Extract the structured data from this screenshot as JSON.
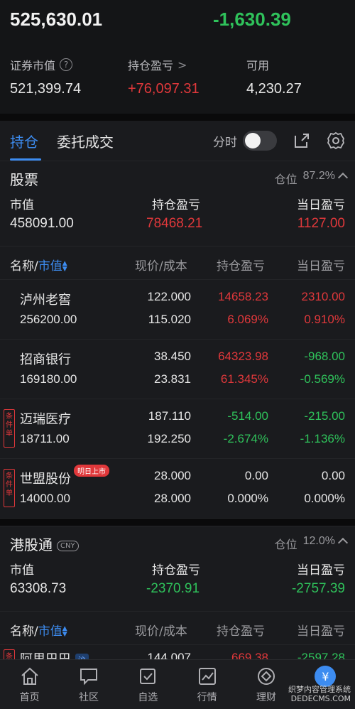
{
  "summary": {
    "total_assets": "525,630.01",
    "today_change": "-1,630.39",
    "market_value_label": "证券市值",
    "market_value": "521,399.74",
    "holding_pnl_label": "持仓盈亏",
    "holding_pnl": "+76,097.31",
    "available_label": "可用",
    "available": "4,230.27"
  },
  "tabs": {
    "positions": "持仓",
    "orders": "委托成交",
    "timeshare": "分时"
  },
  "stocks_section": {
    "title": "股票",
    "position_label": "仓位",
    "position_value": "87.2%",
    "mv_label": "市值",
    "mv_value": "458091.00",
    "hold_label": "持仓盈亏",
    "hold_value": "78468.21",
    "day_label": "当日盈亏",
    "day_value": "1127.00"
  },
  "col_headers": {
    "name": "名称/",
    "mv": "市值",
    "price": "现价/成本",
    "hold": "持仓盈亏",
    "day": "当日盈亏"
  },
  "stocks": [
    {
      "name": "泸州老窖",
      "qty": "256200.00",
      "price": "122.000",
      "cost": "115.020",
      "hold": "14658.23",
      "hold_pct": "6.069%",
      "day": "2310.00",
      "day_pct": "0.910%",
      "hold_color": "#e0383b",
      "day_color": "#e0383b"
    },
    {
      "name": "招商银行",
      "qty": "169180.00",
      "price": "38.450",
      "cost": "23.831",
      "hold": "64323.98",
      "hold_pct": "61.345%",
      "day": "-968.00",
      "day_pct": "-0.569%",
      "hold_color": "#e0383b",
      "day_color": "#2fc25b"
    },
    {
      "name": "迈瑞医疗",
      "qty": "18711.00",
      "price": "187.110",
      "cost": "192.250",
      "hold": "-514.00",
      "hold_pct": "-2.674%",
      "day": "-215.00",
      "day_pct": "-1.136%",
      "hold_color": "#2fc25b",
      "day_color": "#2fc25b",
      "tag": "条件单"
    },
    {
      "name": "世盟股份",
      "qty": "14000.00",
      "price": "28.000",
      "cost": "28.000",
      "hold": "0.00",
      "hold_pct": "0.000%",
      "day": "0.00",
      "day_pct": "0.000%",
      "hold_color": "#e6e6e6",
      "day_color": "#e6e6e6",
      "tag": "条件单",
      "badge": "明日上市"
    }
  ],
  "hk_section": {
    "title": "港股通",
    "currency": "CNY",
    "position_label": "仓位",
    "position_value": "12.0%",
    "mv_label": "市值",
    "mv_value": "63308.73",
    "hold_label": "持仓盈亏",
    "hold_value": "-2370.91",
    "day_label": "当日盈亏",
    "day_value": "-2757.39"
  },
  "hk_stocks": [
    {
      "name": "阿里巴巴",
      "market": "沪",
      "price": "144.007",
      "hold": "669.38",
      "day": "-2597.28",
      "tag": "条"
    }
  ],
  "nav": {
    "home": "首页",
    "community": "社区",
    "watchlist": "自选",
    "market": "行情",
    "wealth": "理财",
    "trade_icon": "¥"
  },
  "watermark": {
    "line1": "织梦内容管理系统",
    "line2": "DEDECMS.COM"
  },
  "colors": {
    "accent": "#3d8cf0",
    "up": "#e0383b",
    "down": "#2fc25b"
  }
}
